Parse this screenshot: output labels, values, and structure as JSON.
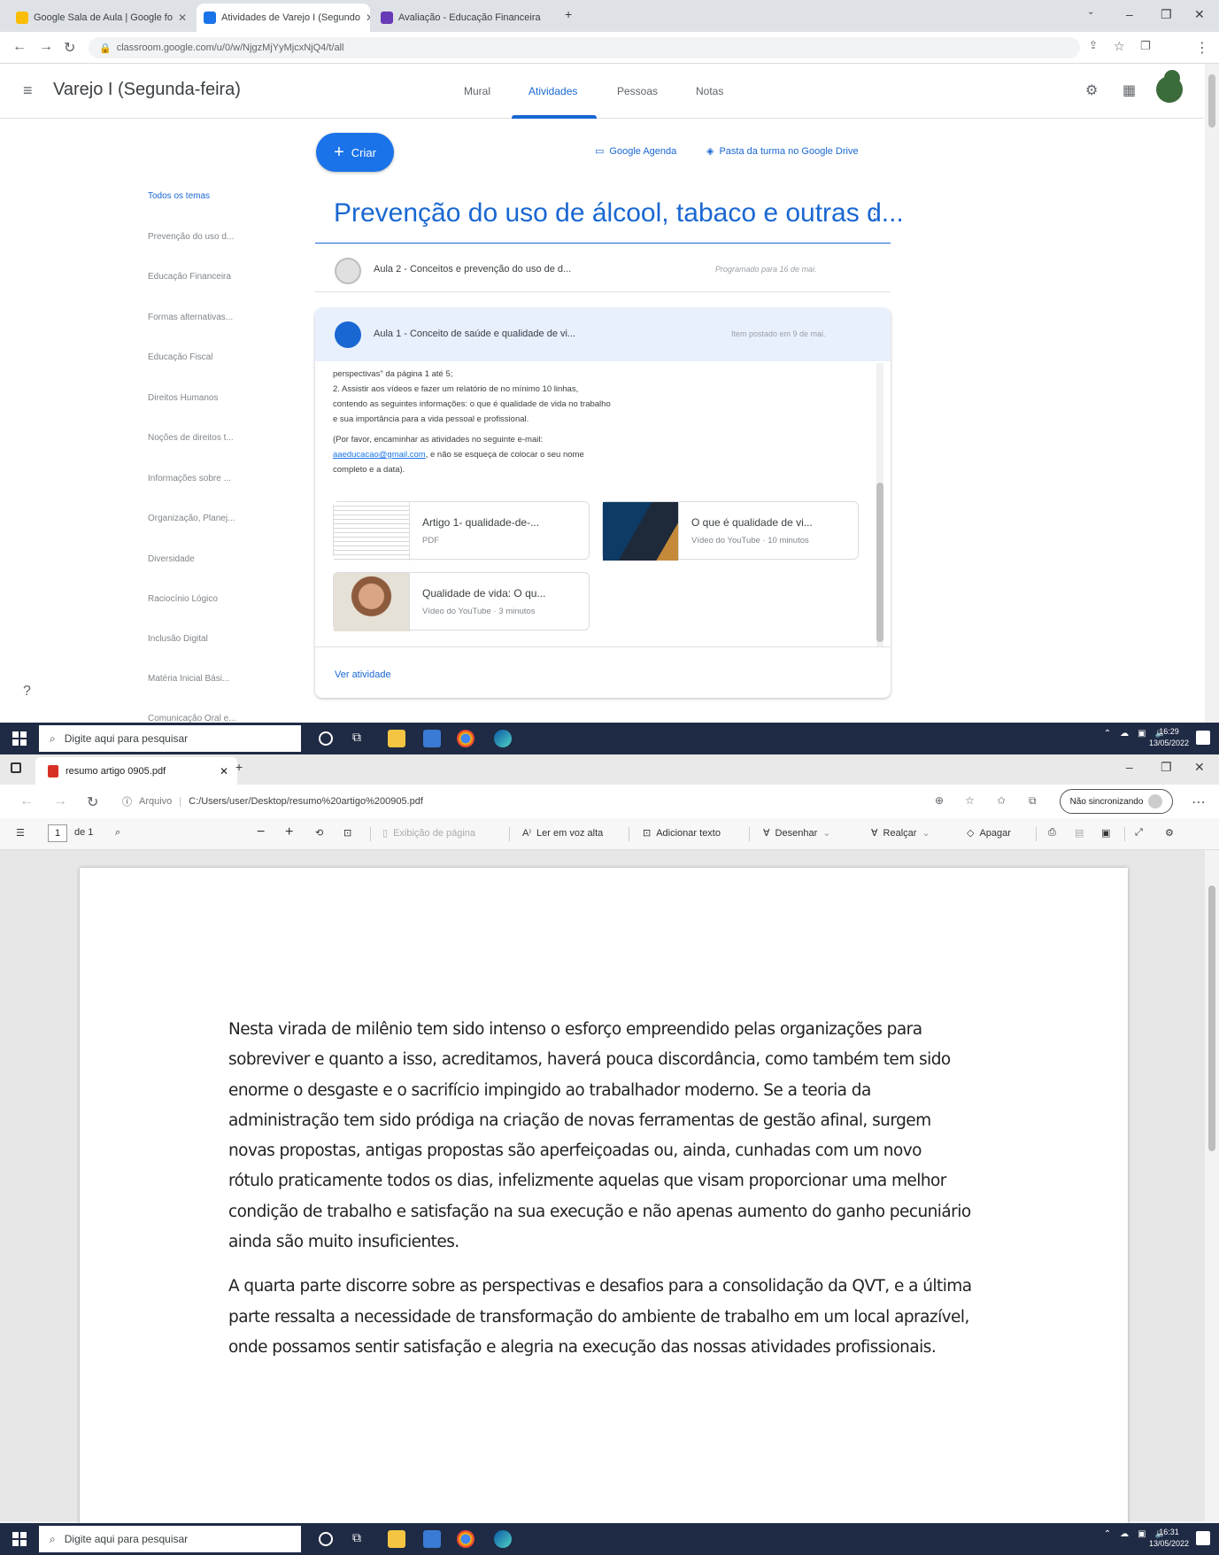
{
  "top_window": {
    "tabs": [
      {
        "label": "Google Sala de Aula | Google fo",
        "active": false
      },
      {
        "label": "Atividades de Varejo I (Segundo",
        "active": true
      },
      {
        "label": "Avaliação - Educação Financeira",
        "active": false
      }
    ],
    "url": "classroom.google.com/u/0/w/NjgzMjYyMjcxNjQ4/t/all",
    "classroom": {
      "class_name": "Varejo I (Segunda-feira)",
      "nav": [
        "Mural",
        "Atividades",
        "Pessoas",
        "Notas"
      ],
      "create_label": "Criar",
      "calendar_link": "Google Agenda",
      "drive_link": "Pasta da turma no Google Drive",
      "topics": [
        "Todos os temas",
        "Prevenção do uso d...",
        "Educação Financeira",
        "Formas alternativas...",
        "Educação Fiscal",
        "Direitos Humanos",
        "Noções de direitos t...",
        "Informações sobre ...",
        "Organização, Planej...",
        "Diversidade",
        "Raciocínio Lógico",
        "Inclusão Digital",
        "Matéria Inicial Bási...",
        "Comunicação Oral e..."
      ],
      "topic_heading": "Prevenção do uso de álcool, tabaco e outras d...",
      "assignments": [
        {
          "title": "Aula 2 - Conceitos e prevenção do uso de d...",
          "meta": "Programado para 16 de mai."
        },
        {
          "title": "Aula 1 - Conceito de saúde e qualidade de vi...",
          "meta": "Item postado em 9 de mai."
        }
      ],
      "assignment_body": {
        "p1_lines": [
          "perspectivas\" da página 1 até 5;",
          "2. Assistir aos vídeos e fazer um relatório de no mínimo 10 linhas,",
          "contendo as seguintes informações: o que é qualidade de vida no trabalho",
          "e sua importância para a vida pessoal e profissional."
        ],
        "p2_line1": "(Por favor, encaminhar as atividades no seguinte e-mail:",
        "email": "aaeducacao@gmail.com",
        "p2_line2_rest": ", e não se esqueça de colocar o seu nome",
        "p2_line3": "completo e a data)."
      },
      "attachments": [
        {
          "title": "Artigo 1- qualidade-de-...",
          "subtitle": "PDF"
        },
        {
          "title": "O que é qualidade de vi...",
          "subtitle": "Vídeo do YouTube · 10 minutos"
        },
        {
          "title": "Qualidade de vida: O qu...",
          "subtitle": "Vídeo do YouTube · 3 minutos"
        }
      ],
      "view_activity": "Ver atividade"
    },
    "taskbar": {
      "search_placeholder": "Digite aqui para pesquisar",
      "time": "16:29",
      "date": "13/05/2022"
    }
  },
  "bottom_window": {
    "tab_label": "resumo artigo 0905.pdf",
    "url_prefix": "Arquivo",
    "url": "C:/Users/user/Desktop/resumo%20artigo%200905.pdf",
    "sync_label": "Não sincronizando",
    "pdf_toolbar": {
      "page_current": "1",
      "page_total": "de 1",
      "page_view": "Exibição de página",
      "read_aloud": "Ler em voz alta",
      "add_text": "Adicionar texto",
      "draw": "Desenhar",
      "highlight": "Realçar",
      "erase": "Apagar"
    },
    "pdf_lines": [
      "Nesta virada de milênio tem sido intenso o esforço empreendido pelas organizações para",
      "sobreviver e quanto a isso, acreditamos, haverá pouca discordância, como também tem sido",
      "enorme o desgaste e o sacrifício impingido ao trabalhador moderno. Se a teoria da",
      "administração tem sido pródiga na criação de novas ferramentas de gestão afinal, surgem",
      "novas propostas, antigas propostas são aperfeiçoadas ou, ainda, cunhadas com um novo",
      "rótulo praticamente todos os dias, infelizmente aquelas que visam proporcionar uma melhor",
      "condição de trabalho e satisfação na sua execução e não apenas aumento do ganho pecuniário",
      "ainda são muito insuficientes."
    ],
    "pdf_lines_2": [
      "A quarta parte discorre sobre as perspectivas e desafios para a consolidação da QVT, e a última",
      "parte ressalta a necessidade de transformação do ambiente de trabalho em um local aprazível,",
      "onde possamos sentir satisfação e alegria na execução das nossas atividades profissionais."
    ],
    "taskbar": {
      "search_placeholder": "Digite aqui para pesquisar",
      "time": "16:31",
      "date": "13/05/2022"
    }
  },
  "colors": {
    "classroom_blue": "#1967d2",
    "create_button": "#1a73e8",
    "card_header": "#e8f0fe",
    "taskbar": "#1f2a44"
  }
}
